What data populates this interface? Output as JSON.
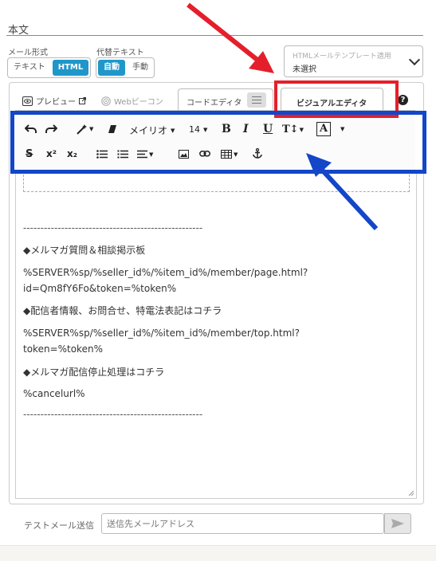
{
  "section": {
    "title": "本文"
  },
  "mail_format": {
    "label": "メール形式",
    "options": [
      "テキスト",
      "HTML"
    ],
    "selected": "HTML"
  },
  "alt_text": {
    "label": "代替テキスト",
    "options": [
      "自動",
      "手動"
    ],
    "selected": "自動"
  },
  "template_select": {
    "placeholder": "HTMLメールテンプレート適用",
    "value": "未選択"
  },
  "tabs": {
    "preview": "プレビュー",
    "web_beacon": "Webビーコン",
    "code_editor": "コードエディタ",
    "visual_editor": "ビジュアルエディタ",
    "help": "?"
  },
  "toolbar": {
    "font_name": "メイリオ",
    "font_size": "14",
    "bold": "B",
    "italic": "I",
    "underline": "U",
    "text_color": "A",
    "line_height": "T↕",
    "superscript": "x²",
    "subscript": "x₂"
  },
  "content": {
    "lines": [
      "----------------------------------------------------",
      "◆メルマガ質問＆相談掲示板",
      "%SERVER%sp/%seller_id%/%item_id%/member/page.html?",
      "id=Qm8fY6Fo&token=%token%",
      "◆配信者情報、お問合せ、特電法表記はコチラ",
      "%SERVER%sp/%seller_id%/%item_id%/member/top.html?",
      "token=%token%",
      "◆メルマガ配信停止処理はコチラ",
      "%cancelurl%",
      "----------------------------------------------------"
    ]
  },
  "test_mail": {
    "label": "テストメール送信",
    "placeholder": "送信先メールアドレス"
  },
  "colors": {
    "accent": "#1f97c9",
    "red_annotation": "#e41f2b",
    "blue_annotation": "#1346c8"
  }
}
